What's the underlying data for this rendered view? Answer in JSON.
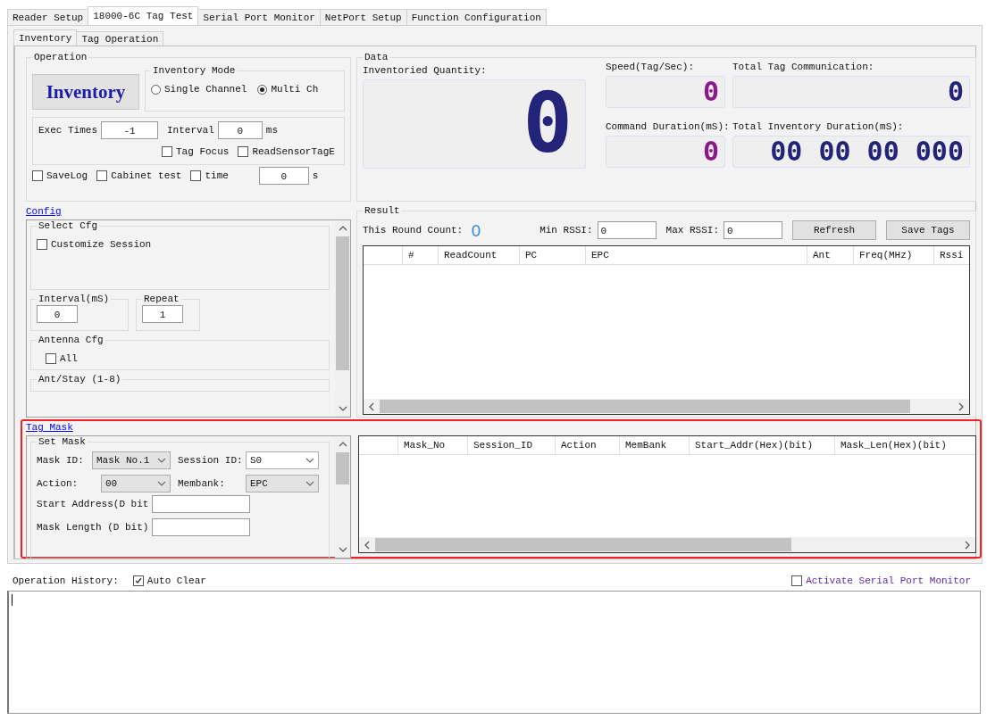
{
  "tabs": [
    {
      "label": "Reader Setup",
      "selected": false
    },
    {
      "label": "18000-6C Tag Test",
      "selected": true
    },
    {
      "label": "Serial Port Monitor",
      "selected": false
    },
    {
      "label": "NetPort Setup",
      "selected": false
    },
    {
      "label": "Function Configuration",
      "selected": false
    }
  ],
  "subtabs": [
    {
      "label": "Inventory",
      "selected": true
    },
    {
      "label": "Tag Operation",
      "selected": false
    }
  ],
  "operation": {
    "title": "Operation",
    "inventory_button": "Inventory",
    "mode": {
      "title": "Inventory Mode",
      "options": [
        {
          "label": "Single Channel",
          "selected": false
        },
        {
          "label": "Multi Ch",
          "selected": true
        }
      ]
    },
    "exec_times": {
      "label": "Exec Times",
      "value": "-1"
    },
    "interval": {
      "label": "Interval",
      "value": "0",
      "unit": "ms"
    },
    "options": [
      {
        "label": "Tag Focus",
        "checked": false
      },
      {
        "label": "ReadSensorTagE",
        "checked": false
      }
    ],
    "log_options": [
      {
        "label": "SaveLog",
        "checked": false
      },
      {
        "label": "Cabinet test",
        "checked": false
      },
      {
        "label": "time",
        "checked": false
      }
    ],
    "time": {
      "value": "0",
      "unit": "s"
    }
  },
  "data": {
    "title": "Data",
    "displays": [
      {
        "label": "Inventoried Quantity:",
        "value": "0",
        "color": "#23237a"
      },
      {
        "label": "Speed(Tag/Sec):",
        "value": "0",
        "color": "#8a1a8a"
      },
      {
        "label": "Total Tag Communication:",
        "value": "0",
        "color": "#23237a"
      },
      {
        "label": "Command Duration(mS):",
        "value": "0",
        "color": "#8a1a8a"
      },
      {
        "label": "Total Inventory Duration(mS):",
        "value": "00 00 00 000",
        "color": "#23237a"
      }
    ]
  },
  "result": {
    "title": "Result",
    "round_count": {
      "label": "This Round Count:",
      "value": "0"
    },
    "min_rssi": {
      "label": "Min RSSI:",
      "value": "0"
    },
    "max_rssi": {
      "label": "Max RSSI:",
      "value": "0"
    },
    "buttons": [
      "Refresh",
      "Save Tags"
    ],
    "table": {
      "columns": [
        "#",
        "ReadCount",
        "PC",
        "EPC",
        "Ant",
        "Freq(MHz)",
        "Rssi"
      ]
    }
  },
  "config": {
    "link": "Config",
    "select_cfg": {
      "title": "Select Cfg",
      "option": {
        "label": "Customize Session",
        "checked": false
      }
    },
    "interval": {
      "title": "Interval(mS)",
      "value": "0"
    },
    "repeat": {
      "title": "Repeat",
      "value": "1"
    },
    "antenna": {
      "title": "Antenna Cfg",
      "option": {
        "label": "All",
        "checked": false
      }
    },
    "ant_stay": {
      "title": "Ant/Stay (1-8)"
    }
  },
  "tag_mask": {
    "link": "Tag Mask",
    "highlighted": true,
    "title": "Set Mask",
    "selects": [
      {
        "label": "Mask ID:",
        "value": "Mask No.1",
        "disabled": true
      },
      {
        "label": "Session ID:",
        "value": "S0",
        "disabled": false
      },
      {
        "label": "Action:",
        "value": "00",
        "disabled": true
      },
      {
        "label": "Membank:",
        "value": "EPC",
        "disabled": true
      }
    ],
    "inputs": [
      {
        "label": "Start Address(D bit"
      },
      {
        "label": "Mask Length (D bit)"
      }
    ],
    "table": {
      "columns": [
        "Mask_No",
        "Session_ID",
        "Action",
        "MemBank",
        "Start_Addr(Hex)(bit)",
        "Mask_Len(Hex)(bit)"
      ]
    }
  },
  "history": {
    "label": "Operation History:",
    "auto_clear": {
      "label": "Auto Clear",
      "checked": true
    },
    "serial_monitor": {
      "label": "Activate Serial Port Monitor",
      "checked": false
    }
  }
}
